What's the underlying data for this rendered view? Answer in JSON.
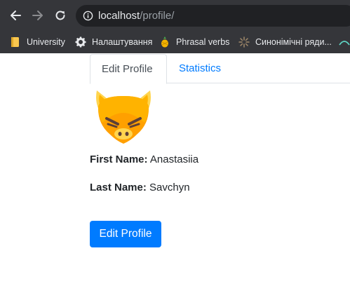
{
  "browser": {
    "url_host": "localhost",
    "url_path": "/profile/",
    "bookmarks": [
      {
        "label": "University",
        "icon": "folder-icon"
      },
      {
        "label": "Налаштування",
        "icon": "gear-icon"
      },
      {
        "label": "Phrasal verbs",
        "icon": "pineapple-icon"
      },
      {
        "label": "Синонімічні ряди...",
        "icon": "sparkle-icon"
      }
    ]
  },
  "tabs": [
    {
      "label": "Edit Profile",
      "active": true
    },
    {
      "label": "Statistics",
      "active": false
    }
  ],
  "profile": {
    "first_name_label": "First Name:",
    "first_name": "Anastasiia",
    "last_name_label": "Last Name:",
    "last_name": "Savchyn",
    "avatar_icon": "angry-pig-icon"
  },
  "edit_button_label": "Edit Profile",
  "colors": {
    "primary": "#007bff",
    "chrome_dark": "#35363a",
    "omnibox": "#202124"
  }
}
